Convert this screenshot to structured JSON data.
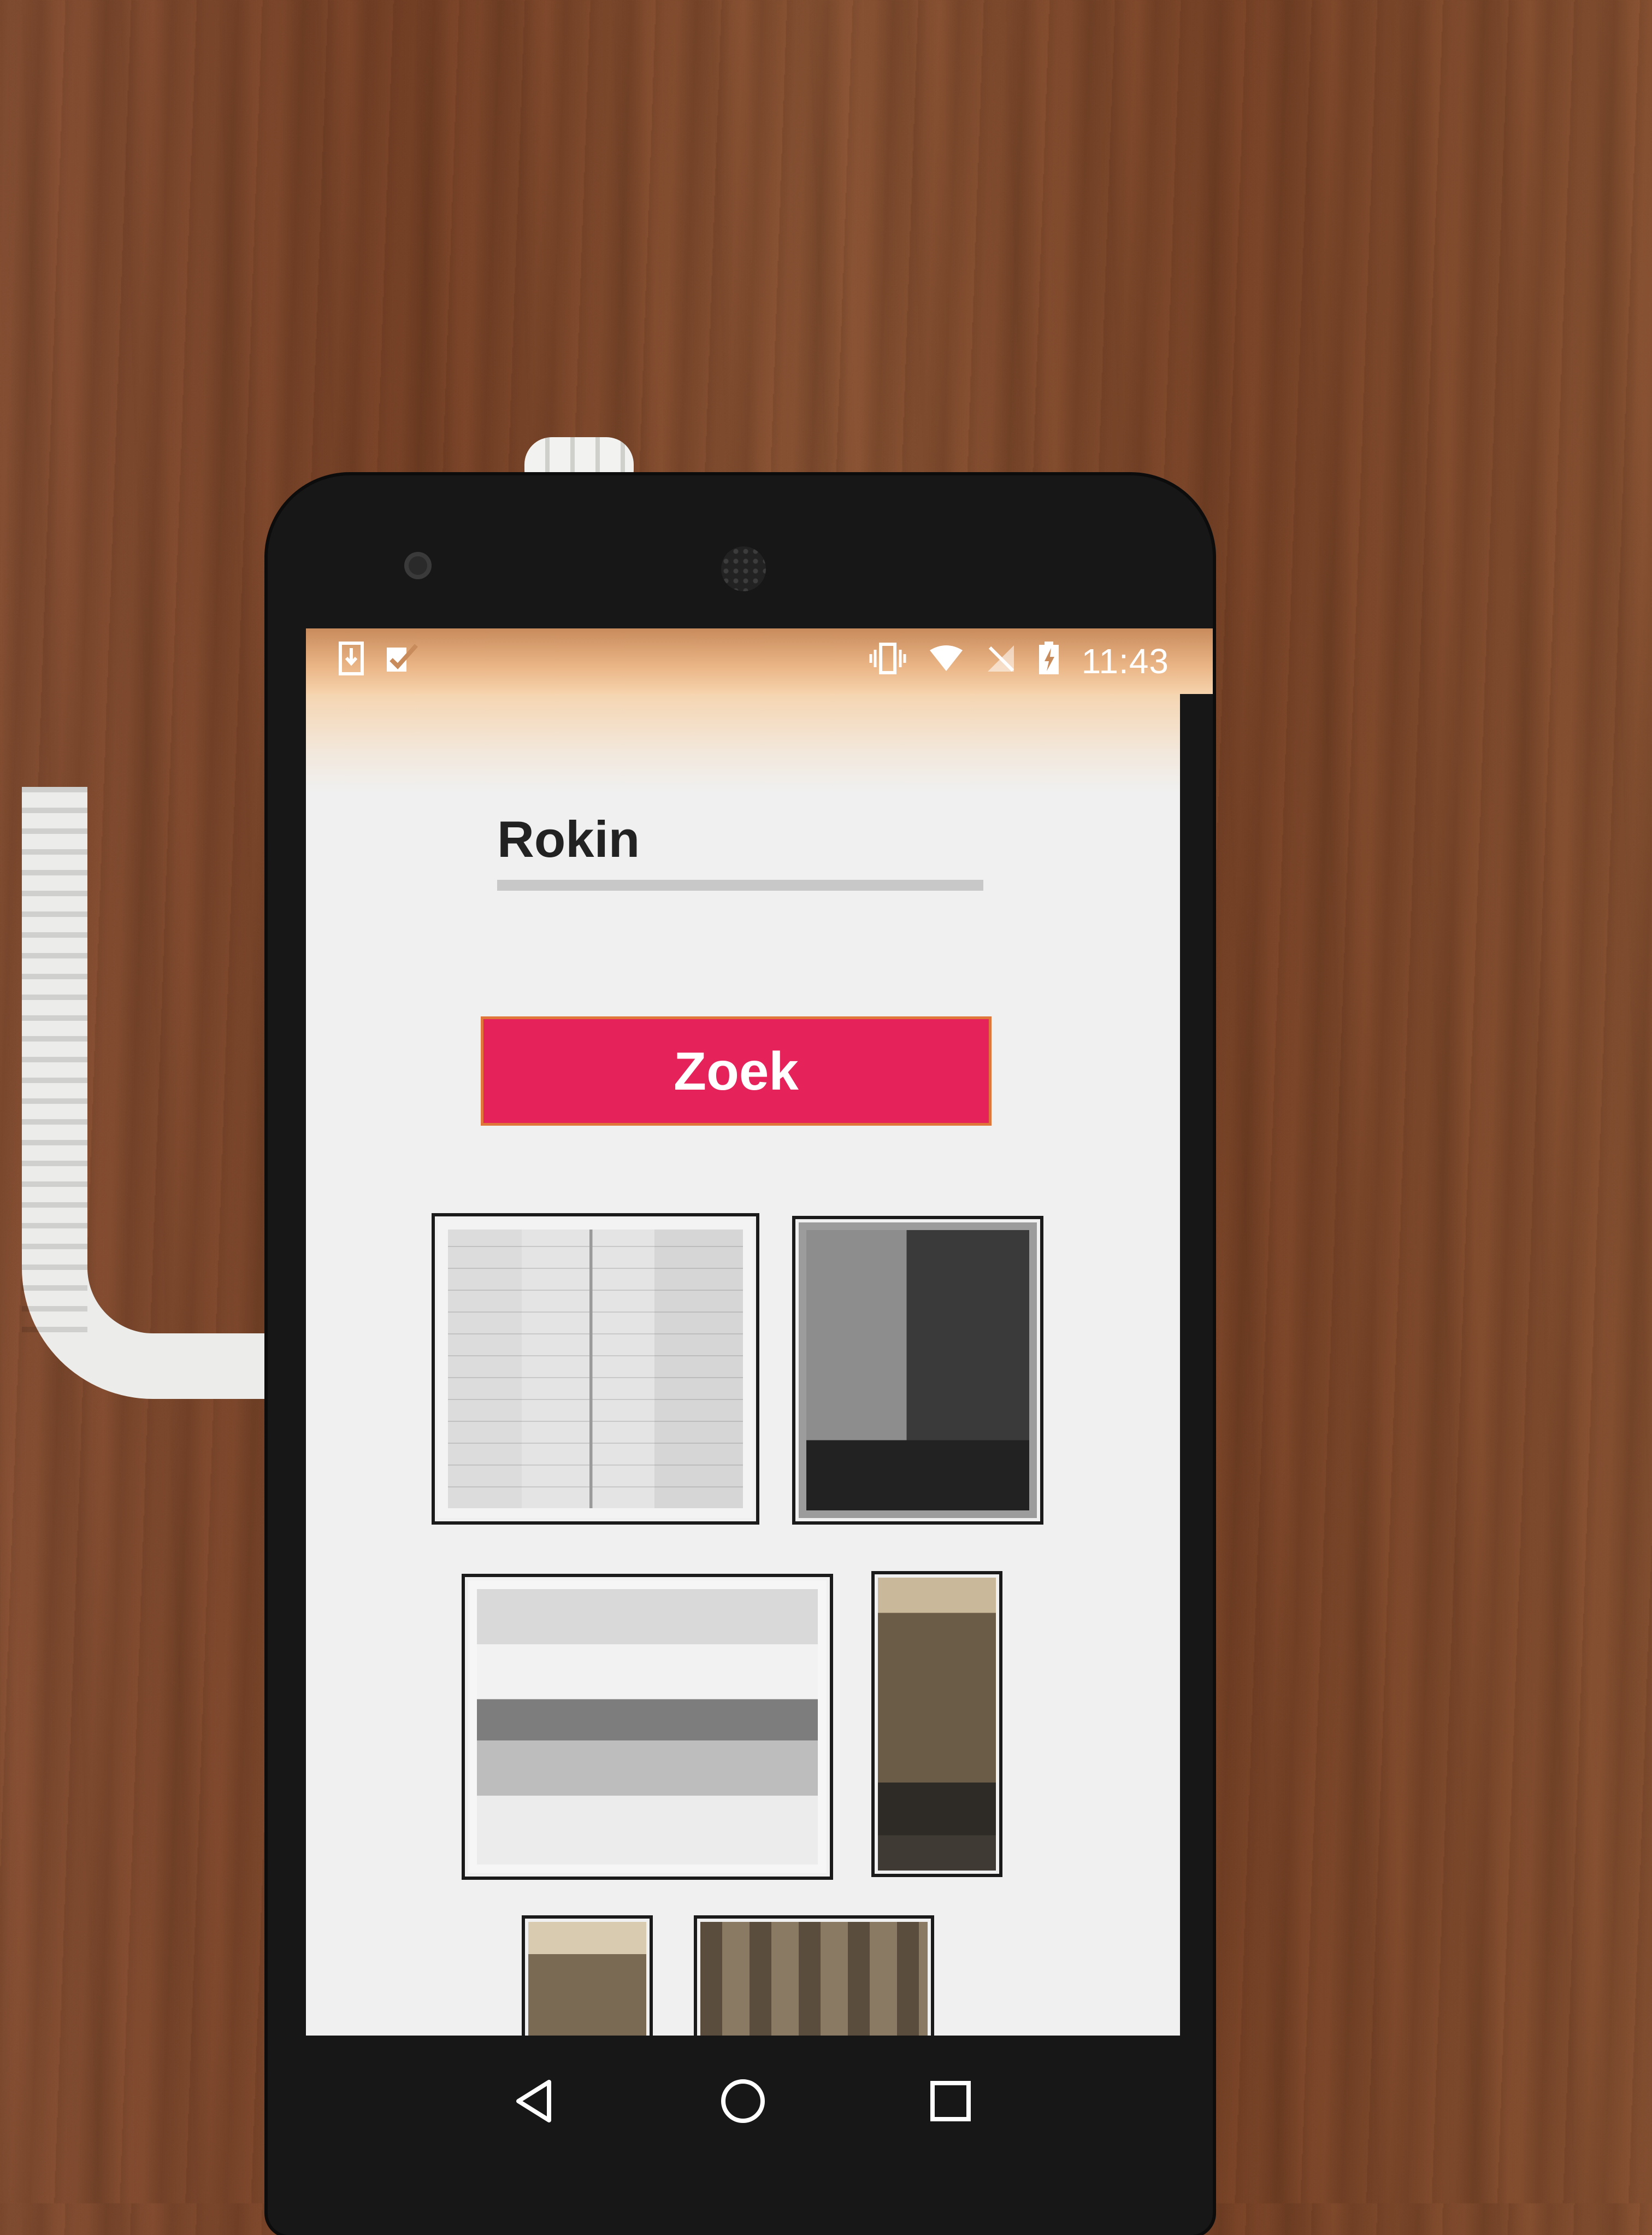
{
  "status_bar": {
    "icons_left": [
      "download-icon",
      "task-check-icon"
    ],
    "icons_right": [
      "vibrate-icon",
      "wifi-icon",
      "no-signal-icon",
      "battery-charging-icon"
    ],
    "time": "11:43"
  },
  "search": {
    "value": "Rokin"
  },
  "search_button": {
    "label": "Zoek",
    "color": "#e6225b"
  },
  "results": {
    "thumbnails": [
      {
        "kind": "architectural drawing"
      },
      {
        "kind": "map and plan"
      },
      {
        "kind": "street sketch"
      },
      {
        "kind": "building photo"
      },
      {
        "kind": "building photo"
      },
      {
        "kind": "facade photo"
      }
    ]
  },
  "navigation": {
    "buttons": [
      "back-icon",
      "home-icon",
      "recents-icon"
    ]
  }
}
